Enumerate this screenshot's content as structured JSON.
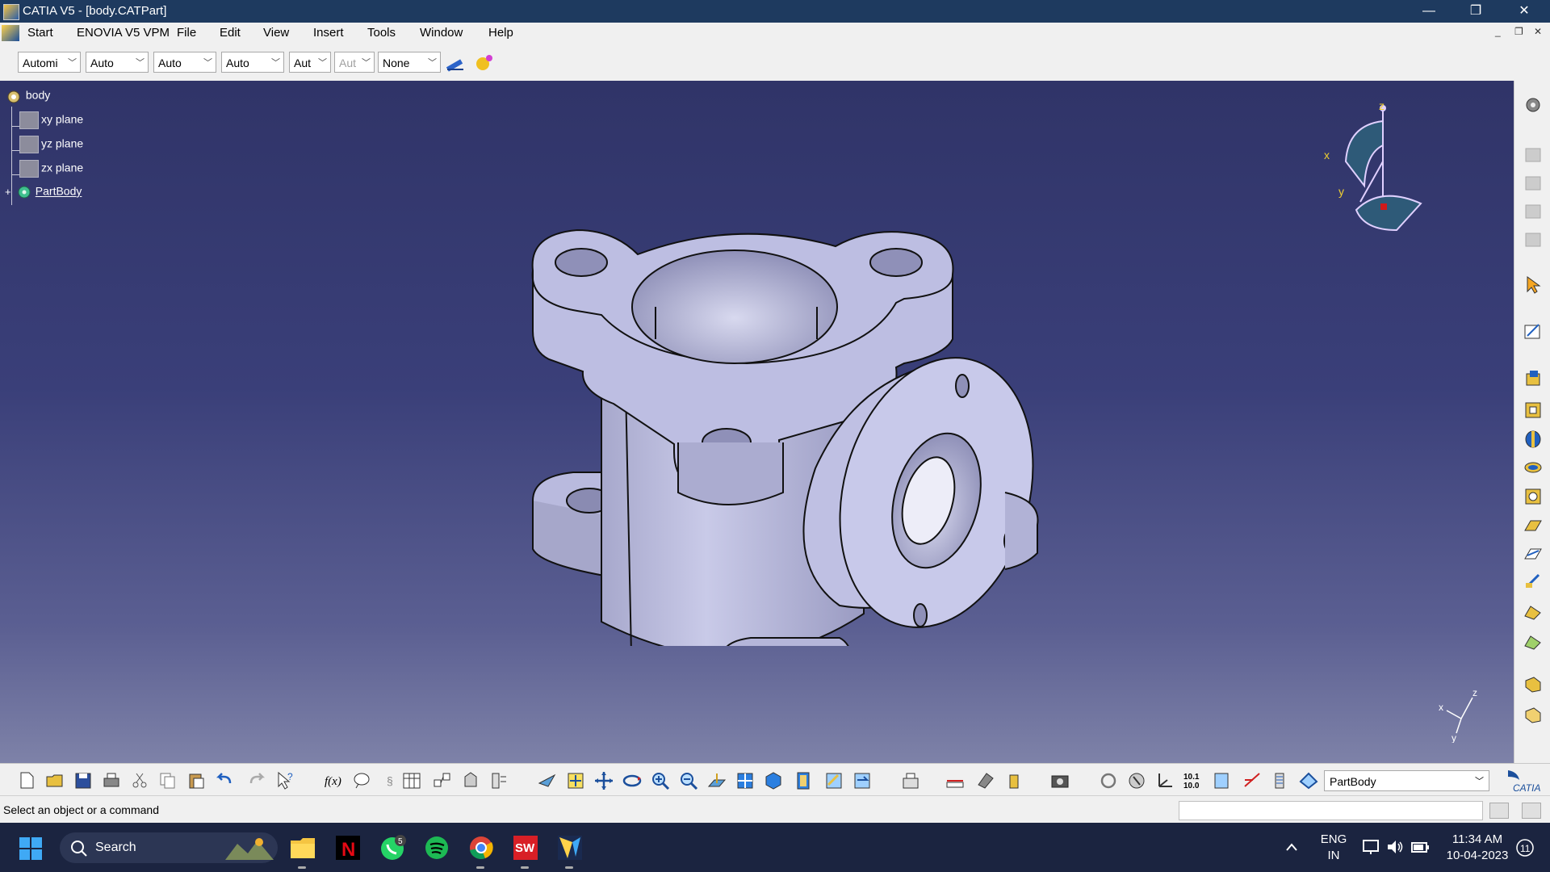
{
  "window": {
    "title": "CATIA V5 - [body.CATPart]",
    "minimize": "—",
    "restore": "❐",
    "close": "✕"
  },
  "menu": {
    "start": "Start",
    "enovia": "ENOVIA V5 VPM",
    "file": "File",
    "edit": "Edit",
    "view": "View",
    "insert": "Insert",
    "tools": "Tools",
    "window": "Window",
    "help": "Help"
  },
  "toolbar_top": {
    "combos": [
      "Automi",
      "Auto",
      "Auto",
      "Auto",
      "Aut",
      "Aut",
      "None"
    ]
  },
  "tree": {
    "root": "body",
    "planes": [
      "xy plane",
      "yz plane",
      "zx plane"
    ],
    "partbody": "PartBody"
  },
  "compass": {
    "x": "x",
    "y": "y",
    "z": "z"
  },
  "axis": {
    "x": "x",
    "y": "y",
    "z": "z"
  },
  "bottom_toolbar": {
    "fog_label": "f(x)",
    "measure_label": "10.1\n10.0",
    "current_body": "PartBody",
    "catia_logo": "CATIA"
  },
  "status": {
    "message": "Select an object or a command"
  },
  "taskbar": {
    "search": "Search",
    "whatsapp_badge": "5",
    "lang_top": "ENG",
    "lang_bottom": "IN",
    "time": "11:34 AM",
    "date": "10-04-2023",
    "notif_count": "11"
  },
  "colors": {
    "titlebar": "#1e3a5f",
    "viewport_top": "#303468",
    "part": "#c3c4e6"
  }
}
